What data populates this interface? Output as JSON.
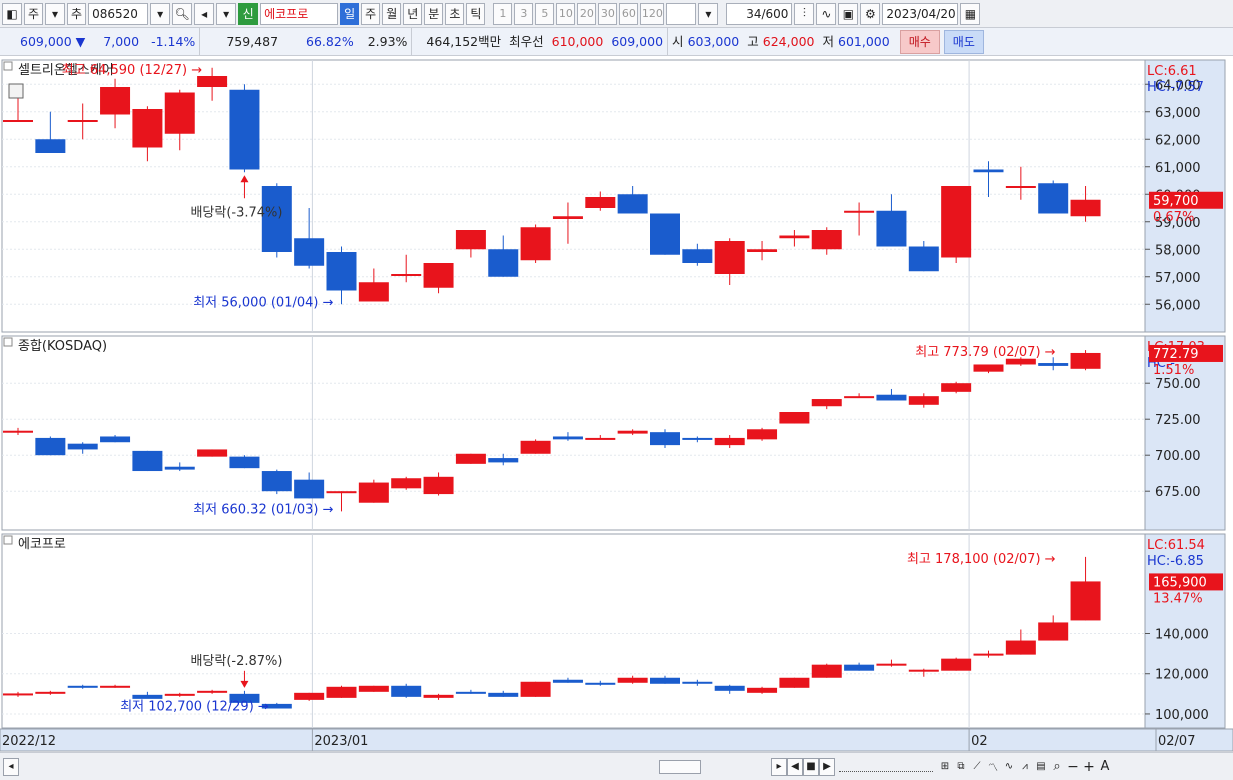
{
  "toolbar": {
    "type_label": "주",
    "add_label": "추",
    "code": "086520",
    "badge": "신",
    "name": "에코프로",
    "periods": [
      "일",
      "주",
      "월",
      "년",
      "분",
      "초",
      "틱"
    ],
    "active_period": "일",
    "intervals": [
      "1",
      "3",
      "5",
      "10",
      "20",
      "30",
      "60",
      "120"
    ],
    "count": "34",
    "count_total": "/600",
    "date": "2023/04/20"
  },
  "quote": {
    "price": "609,000",
    "change": "7,000",
    "change_pct": "-1.14%",
    "volume": "759,487",
    "ratio": "66.82%",
    "turnover": "2.93%",
    "amount": "464,152백만",
    "best_label": "최우선",
    "best_ask": "610,000",
    "best_bid": "609,000",
    "open_label": "시",
    "open": "603,000",
    "high_label": "고",
    "high": "624,000",
    "low_label": "저",
    "low": "601,000",
    "buy_label": "매수",
    "sell_label": "매도"
  },
  "chart_data": [
    {
      "type": "candlestick",
      "title": "셀트리온헬스케어",
      "ylim": [
        55500,
        64300
      ],
      "y_ticks": [
        56000,
        57000,
        58000,
        59000,
        60000,
        61000,
        62000,
        63000,
        64000
      ],
      "tick_labels": [
        "56,000",
        "57,000",
        "58,000",
        "59,000",
        "60,000",
        "61,000",
        "62,000",
        "63,000",
        "64,000"
      ],
      "candles": [
        [
          62700,
          63500,
          62700,
          62700
        ],
        [
          62000,
          63000,
          61800,
          61500
        ],
        [
          62700,
          63300,
          62000,
          62700
        ],
        [
          62900,
          64200,
          62400,
          63900
        ],
        [
          61700,
          63200,
          61200,
          63100
        ],
        [
          62200,
          63800,
          61600,
          63700
        ],
        [
          63900,
          64600,
          63400,
          64300
        ],
        [
          63800,
          64000,
          60800,
          60900
        ],
        [
          60300,
          60400,
          57700,
          57900
        ],
        [
          58400,
          59500,
          57300,
          57400
        ],
        [
          57900,
          58100,
          56000,
          56500
        ],
        [
          56100,
          57300,
          56100,
          56800
        ],
        [
          57100,
          57800,
          56800,
          57100
        ],
        [
          56600,
          57500,
          56400,
          57500
        ],
        [
          58000,
          58700,
          57700,
          58700
        ],
        [
          58000,
          58500,
          57000,
          57000
        ],
        [
          57600,
          58900,
          57500,
          58800
        ],
        [
          59100,
          59700,
          58200,
          59200
        ],
        [
          59500,
          60100,
          59400,
          59900
        ],
        [
          60000,
          60300,
          59300,
          59300
        ],
        [
          59300,
          59300,
          57800,
          57800
        ],
        [
          58000,
          58200,
          57400,
          57500
        ],
        [
          57100,
          58400,
          56700,
          58300
        ],
        [
          57900,
          58300,
          57600,
          58000
        ],
        [
          58400,
          58700,
          58100,
          58500
        ],
        [
          58000,
          58800,
          57800,
          58700
        ],
        [
          59400,
          59700,
          58500,
          59400
        ],
        [
          59400,
          60000,
          58100,
          58100
        ],
        [
          58100,
          58300,
          57200,
          57200
        ],
        [
          57700,
          60300,
          57500,
          60300
        ],
        [
          60900,
          61200,
          59900,
          60800
        ],
        [
          60300,
          61000,
          59800,
          60300
        ],
        [
          60400,
          60500,
          59300,
          59300
        ],
        [
          59200,
          60300,
          59000,
          59800
        ]
      ],
      "indicator": [
        "LC:6.61",
        "HC:-7.57"
      ],
      "last_value": "59,700",
      "last_pct": "0.67%",
      "high_note": "최고 64,590 (12/27)",
      "low_note": "최저 56,000 (01/04)",
      "event_note": "배당락(-3.74%)"
    },
    {
      "type": "candlestick",
      "title": "종합(KOSDAQ)",
      "ylim": [
        655,
        780
      ],
      "y_ticks": [
        675,
        700,
        725,
        750
      ],
      "tick_labels": [
        "675.00",
        "700.00",
        "725.00",
        "750.00"
      ],
      "candles": [
        [
          717,
          719,
          714,
          717
        ],
        [
          712,
          713,
          700,
          700
        ],
        [
          708,
          709,
          701,
          704
        ],
        [
          713,
          714,
          709,
          709
        ],
        [
          703,
          703,
          689,
          689
        ],
        [
          692,
          695,
          689,
          690
        ],
        [
          699,
          704,
          699,
          704
        ],
        [
          699,
          700,
          691,
          691
        ],
        [
          689,
          690,
          673,
          675
        ],
        [
          683,
          688,
          670,
          670
        ],
        [
          674,
          675,
          661,
          675
        ],
        [
          667,
          683,
          667,
          681
        ],
        [
          677,
          685,
          676,
          684
        ],
        [
          673,
          688,
          672,
          685
        ],
        [
          694,
          701,
          694,
          701
        ],
        [
          698,
          701,
          693,
          695
        ],
        [
          701,
          711,
          701,
          710
        ],
        [
          713,
          716,
          710,
          711
        ],
        [
          712,
          714,
          711,
          712
        ],
        [
          715,
          718,
          714,
          717
        ],
        [
          716,
          718,
          705,
          707
        ],
        [
          712,
          713,
          709,
          711
        ],
        [
          707,
          714,
          705,
          712
        ],
        [
          711,
          719,
          710,
          718
        ],
        [
          722,
          730,
          722,
          730
        ],
        [
          734,
          739,
          732,
          739
        ],
        [
          741,
          743,
          740,
          741
        ],
        [
          742,
          746,
          738,
          738
        ],
        [
          735,
          743,
          733,
          741
        ],
        [
          744,
          751,
          743,
          750
        ],
        [
          758,
          763,
          757,
          763
        ],
        [
          763,
          768,
          762,
          767
        ],
        [
          764,
          768,
          759,
          762
        ],
        [
          760,
          773,
          759,
          771
        ]
      ],
      "indicator": [
        "LC:17.03",
        "HC:-"
      ],
      "last_value": "772.79",
      "last_pct": "1.51%",
      "high_note": "최고 773.79 (02/07)",
      "low_note": "최저 660.32 (01/03)"
    },
    {
      "type": "candlestick",
      "title": "에코프로",
      "ylim": [
        95000,
        186000
      ],
      "y_ticks": [
        100000,
        120000,
        140000
      ],
      "tick_labels": [
        "100,000",
        "120,000",
        "140,000"
      ],
      "candles": [
        [
          110000,
          111000,
          108500,
          110200
        ],
        [
          110500,
          111500,
          109500,
          111000
        ],
        [
          114000,
          114500,
          112500,
          113000
        ],
        [
          113500,
          114500,
          113000,
          114000
        ],
        [
          109500,
          111000,
          108000,
          107500
        ],
        [
          109000,
          110500,
          108500,
          110000
        ],
        [
          111000,
          112000,
          110000,
          111500
        ],
        [
          110000,
          111500,
          106000,
          105500
        ],
        [
          105000,
          105500,
          102700,
          102700
        ],
        [
          107000,
          110500,
          106500,
          110500
        ],
        [
          108000,
          114000,
          108000,
          113500
        ],
        [
          111000,
          114000,
          111000,
          114000
        ],
        [
          114000,
          115000,
          108000,
          108500
        ],
        [
          108000,
          110000,
          107000,
          109500
        ],
        [
          111000,
          112000,
          110000,
          110000
        ],
        [
          110500,
          111500,
          108500,
          108500
        ],
        [
          108500,
          116000,
          108500,
          116000
        ],
        [
          117000,
          118000,
          115500,
          115500
        ],
        [
          115500,
          116500,
          114000,
          114500
        ],
        [
          115500,
          119000,
          115000,
          118000
        ],
        [
          118000,
          119000,
          115000,
          115000
        ],
        [
          116000,
          117000,
          114000,
          115000
        ],
        [
          114000,
          114500,
          110000,
          111500
        ],
        [
          110500,
          113500,
          110000,
          113000
        ],
        [
          113000,
          118000,
          113000,
          118000
        ],
        [
          118000,
          125000,
          118000,
          124500
        ],
        [
          124500,
          125500,
          121500,
          121500
        ],
        [
          124000,
          127000,
          123500,
          125000
        ],
        [
          122000,
          122500,
          118500,
          122000
        ],
        [
          121500,
          128000,
          121500,
          127500
        ],
        [
          129000,
          131500,
          128000,
          130000
        ],
        [
          129500,
          142000,
          129500,
          136500
        ],
        [
          136500,
          149000,
          136500,
          145500
        ],
        [
          146500,
          178100,
          146500,
          165900
        ]
      ],
      "indicator": [
        "LC:61.54",
        "HC:-6.85"
      ],
      "last_value": "165,900",
      "last_pct": "13.47%",
      "high_note": "최고 178,100 (02/07)",
      "low_note": "최저 102,700 (12/29)",
      "event_note": "배당락(-2.87%)"
    }
  ],
  "x_axis": {
    "labels": [
      "2022/12",
      "2023/01",
      "02",
      "02/07"
    ]
  },
  "colors": {
    "up": "#e8141c",
    "down": "#1a5ccd",
    "axis_bg": "#dbe6f6"
  }
}
